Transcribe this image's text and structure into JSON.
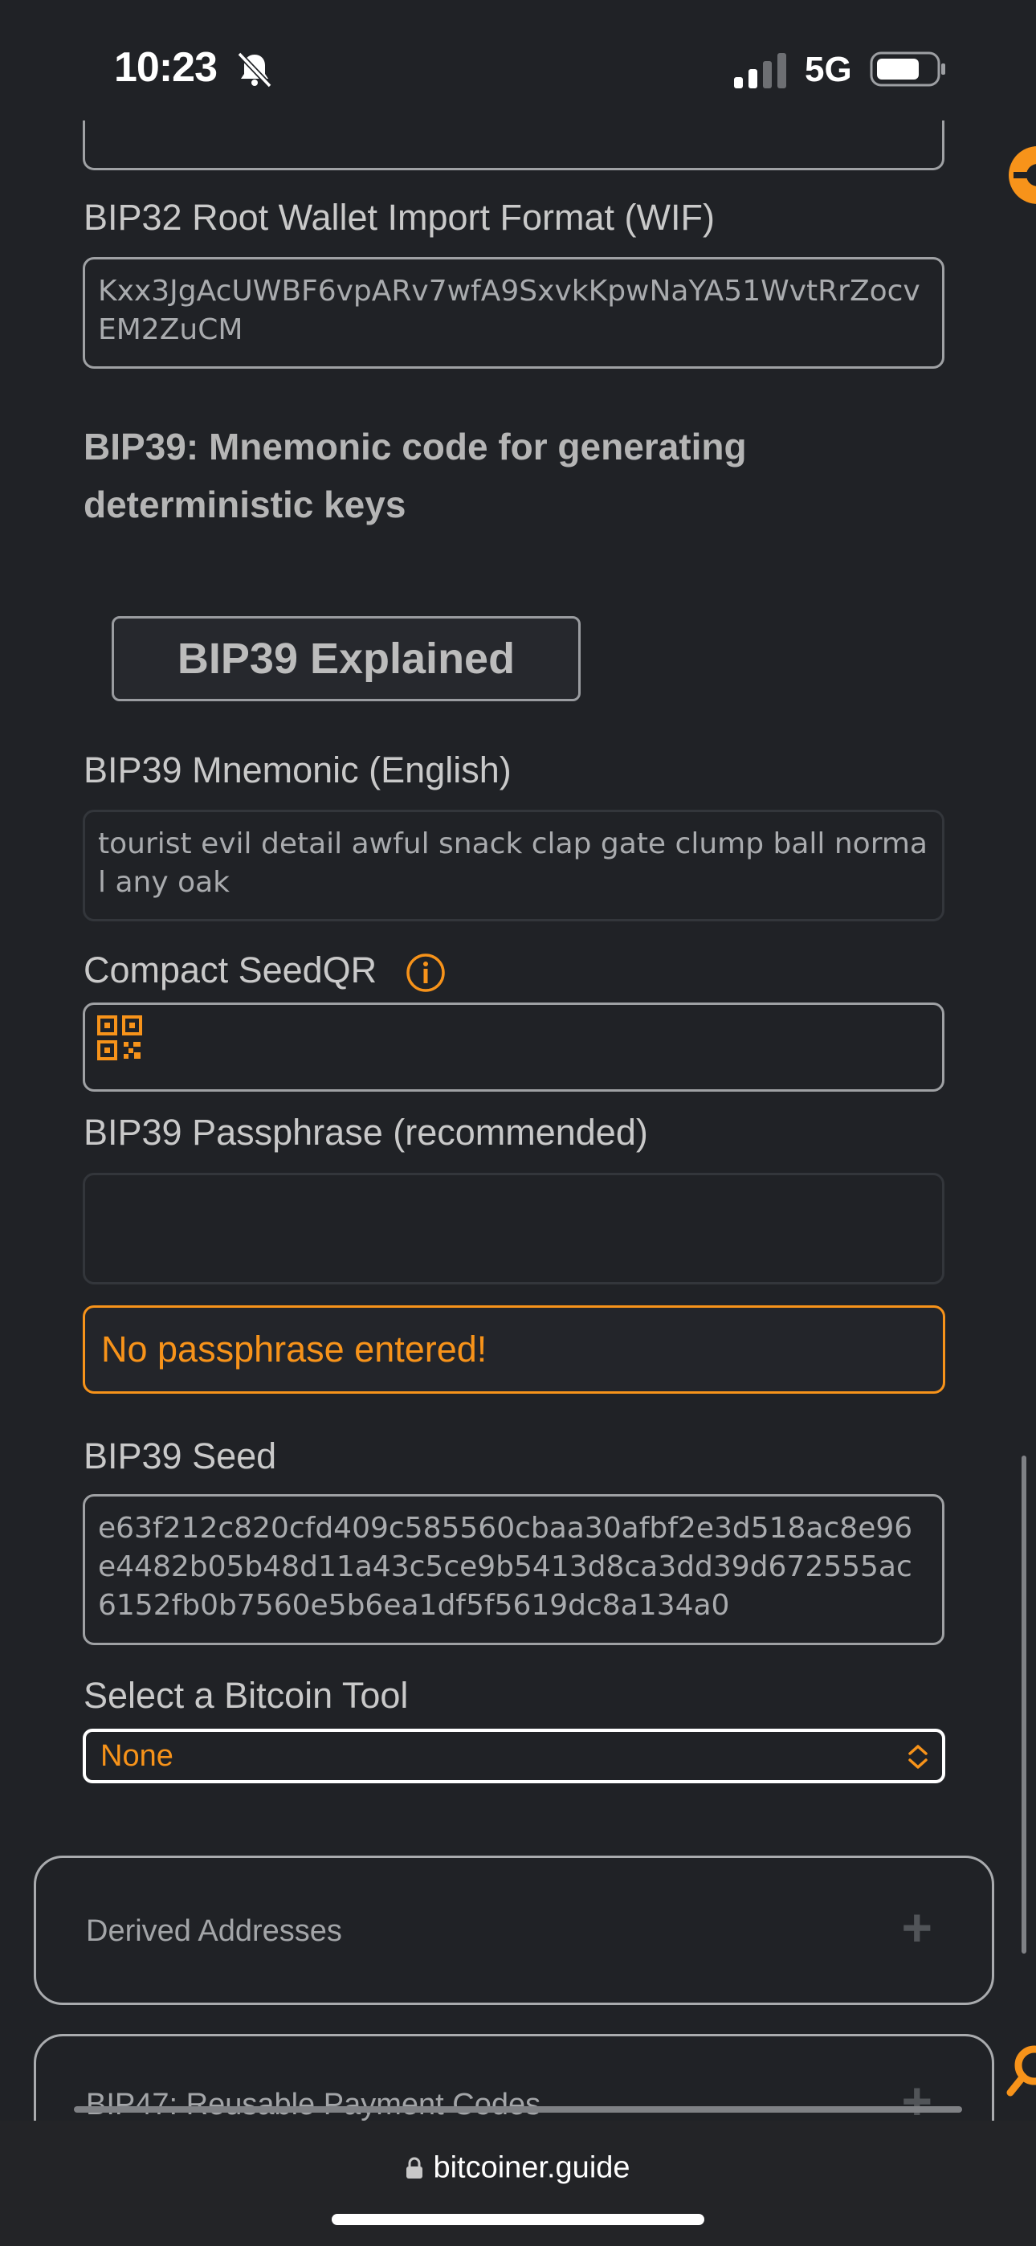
{
  "status_bar": {
    "time": "10:23",
    "network": "5G",
    "icons": [
      "bell-slash-icon",
      "signal-icon",
      "battery-icon"
    ]
  },
  "fields": {
    "wif_label": "BIP32 Root Wallet Import Format (WIF)",
    "wif_value": "Kxx3JgAcUWBF6vpARv7wfA9SxvkKpwNaYA51WvtRrZocvEM2ZuCM",
    "bip39_heading": "BIP39: Mnemonic code for generating deterministic keys",
    "explain_button": "BIP39 Explained",
    "mnemonic_label": "BIP39 Mnemonic (English)",
    "mnemonic_value": "tourist evil detail awful snack clap gate clump ball normal any oak",
    "seedqr_label": "Compact SeedQR",
    "passphrase_label": "BIP39 Passphrase (recommended)",
    "passphrase_value": "",
    "passphrase_warning": "No passphrase entered!",
    "seed_label": "BIP39 Seed",
    "seed_value": "e63f212c820cfd409c585560cbaa30afbf2e3d518ac8e96e4482b05b48d11a43c5ce9b5413d8ca3dd39d672555ac6152fb0b7560e5b6ea1df5f5619dc8a134a0",
    "tool_label": "Select a Bitcoin Tool",
    "tool_selected": "None"
  },
  "panels": [
    {
      "title": "Derived Addresses",
      "toggle": "+"
    },
    {
      "title": "BIP47: Reusable Payment Codes",
      "toggle": "+"
    }
  ],
  "browser": {
    "url": "bitcoiner.guide"
  },
  "colors": {
    "accent": "#f7931a",
    "background": "#202226"
  }
}
